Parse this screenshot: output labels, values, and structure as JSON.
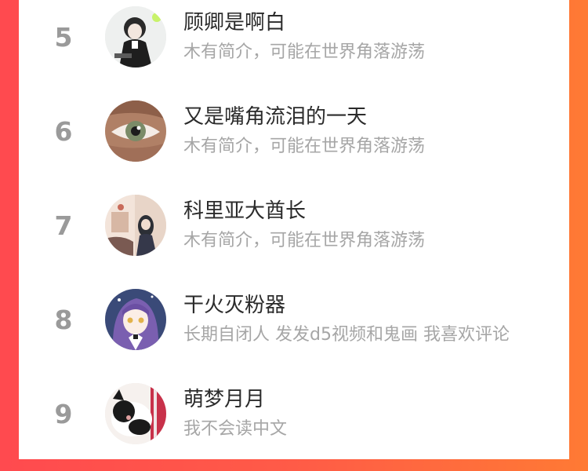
{
  "users": [
    {
      "rank": "5",
      "name": "顾卿是啊白",
      "bio": "木有简介，可能在世界角落游荡",
      "avatar_icon": "avatar-anime-boy-icon"
    },
    {
      "rank": "6",
      "name": "又是嘴角流泪的一天",
      "bio": "木有简介，可能在世界角落游荡",
      "avatar_icon": "avatar-eye-icon"
    },
    {
      "rank": "7",
      "name": "科里亚大酋长",
      "bio": "木有简介，可能在世界角落游荡",
      "avatar_icon": "avatar-scene-icon"
    },
    {
      "rank": "8",
      "name": "干火灭粉器",
      "bio": "长期自闭人 发发d5视频和鬼画 我喜欢评论",
      "avatar_icon": "avatar-anime-girl-icon"
    },
    {
      "rank": "9",
      "name": "萌梦月月",
      "bio": "我不会读中文",
      "avatar_icon": "avatar-cat-icon"
    }
  ],
  "colors": {
    "rank": "#9a9a9a",
    "name": "#2b2b2b",
    "bio": "#a6a6a6",
    "bg_left": "#ff4a4f",
    "bg_right": "#ff7a34"
  }
}
